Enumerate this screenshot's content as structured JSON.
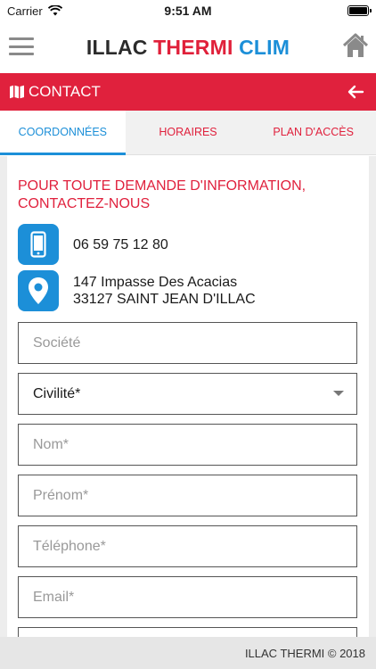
{
  "status": {
    "carrier": "Carrier",
    "time": "9:51 AM",
    "battery_level": 1.0
  },
  "header": {
    "brand_word1": "ILLAC",
    "brand_word2": "THERMI",
    "brand_word3": "CLIM"
  },
  "contact_bar": {
    "title": "CONTACT"
  },
  "tabs": [
    {
      "label": "COORDONNÉES",
      "active": true
    },
    {
      "label": "HORAIRES",
      "active": false
    },
    {
      "label": "PLAN D'ACCÈS",
      "active": false
    }
  ],
  "content": {
    "headline_line1": "POUR TOUTE DEMANDE D'INFORMATION,",
    "headline_line2": "CONTACTEZ-NOUS",
    "phone": "06 59 75 12 80",
    "address_line1": "147 Impasse Des Acacias",
    "address_line2": "33127 SAINT JEAN D'ILLAC"
  },
  "form": {
    "societe_placeholder": "Société",
    "civilite_value": "Civilité*",
    "nom_placeholder": "Nom*",
    "prenom_placeholder": "Prénom*",
    "telephone_placeholder": "Téléphone*",
    "email_placeholder": "Email*"
  },
  "footer": {
    "text": "ILLAC THERMI © 2018"
  },
  "colors": {
    "brand_red": "#e0213d",
    "brand_blue": "#1c8fd8"
  }
}
